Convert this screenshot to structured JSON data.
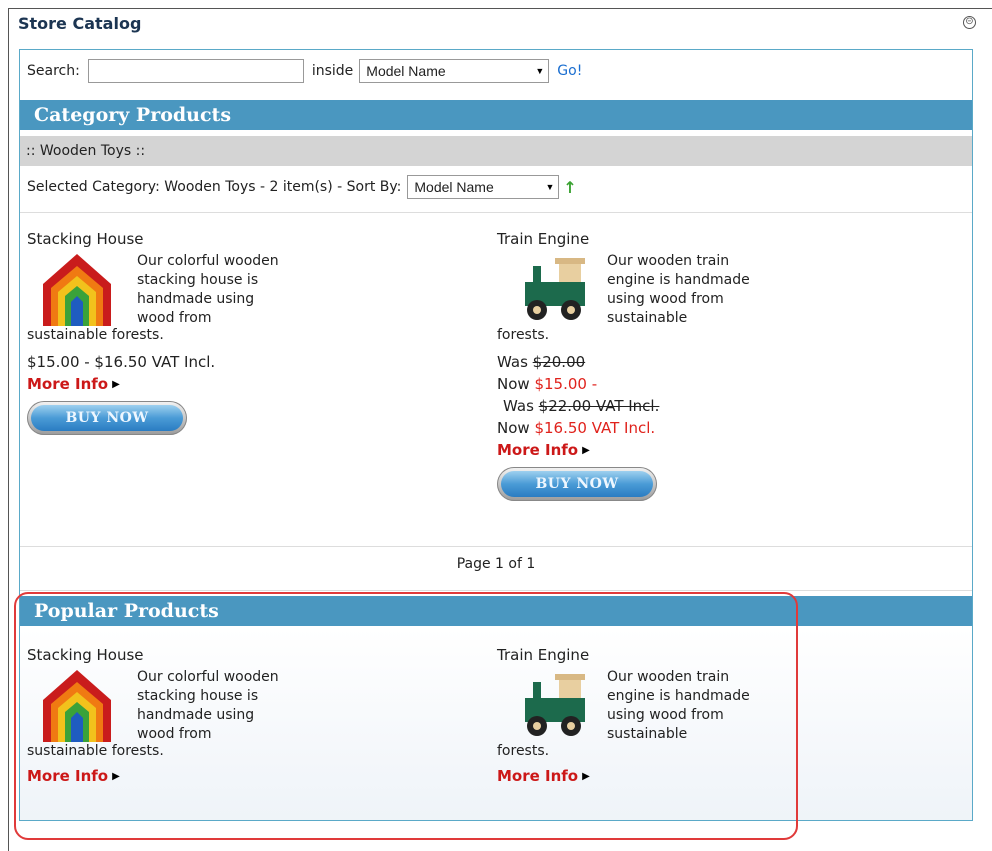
{
  "panel": {
    "title": "Store Catalog",
    "collapse_symbol": "⊝"
  },
  "search": {
    "label": "Search:",
    "value": "",
    "inside_label": "inside",
    "field_selected": "Model Name",
    "go_label": "Go!"
  },
  "category_section": {
    "heading": "Category Products",
    "breadcrumb": ":: Wooden Toys ::",
    "summary": "Selected Category: Wooden Toys - 2 item(s) - Sort By:",
    "sort_selected": "Model Name",
    "sort_direction_icon": "↑",
    "products": [
      {
        "name": "Stacking House",
        "image": "stacking-house-icon",
        "desc_wrap": "Our colorful wooden stacking house is handmade using wood from",
        "desc_tail": "sustainable forests.",
        "price": "$15.00 - $16.50 VAT Incl.",
        "more_info": "More Info",
        "buy_label": "BUY NOW"
      },
      {
        "name": "Train Engine",
        "image": "train-engine-icon",
        "desc_wrap": "Our wooden train engine is handmade using wood from sustainable",
        "desc_tail": "forests.",
        "was_label": "Was",
        "was_price_1": "$20.00",
        "now_label": "Now",
        "now_price_1": "$15.00",
        "dash": "-",
        "was_price_2": "$22.00 VAT Incl.",
        "now_price_2": "$16.50 VAT Incl.",
        "more_info": "More Info",
        "buy_label": "BUY NOW"
      }
    ],
    "pager": "Page 1 of 1"
  },
  "popular_section": {
    "heading": "Popular Products",
    "products": [
      {
        "name": "Stacking House",
        "image": "stacking-house-icon",
        "desc_wrap": "Our colorful wooden stacking house is handmade using wood from",
        "desc_tail": "sustainable forests.",
        "more_info": "More Info"
      },
      {
        "name": "Train Engine",
        "image": "train-engine-icon",
        "desc_wrap": "Our wooden train engine is handmade using wood from sustainable",
        "desc_tail": "forests.",
        "more_info": "More Info"
      }
    ]
  },
  "colors": {
    "section_bar": "#4a97c0",
    "inner_border": "#5aa9c8",
    "link_red": "#cc1818",
    "price_red": "#e0221c",
    "highlight": "#e03a3a"
  }
}
